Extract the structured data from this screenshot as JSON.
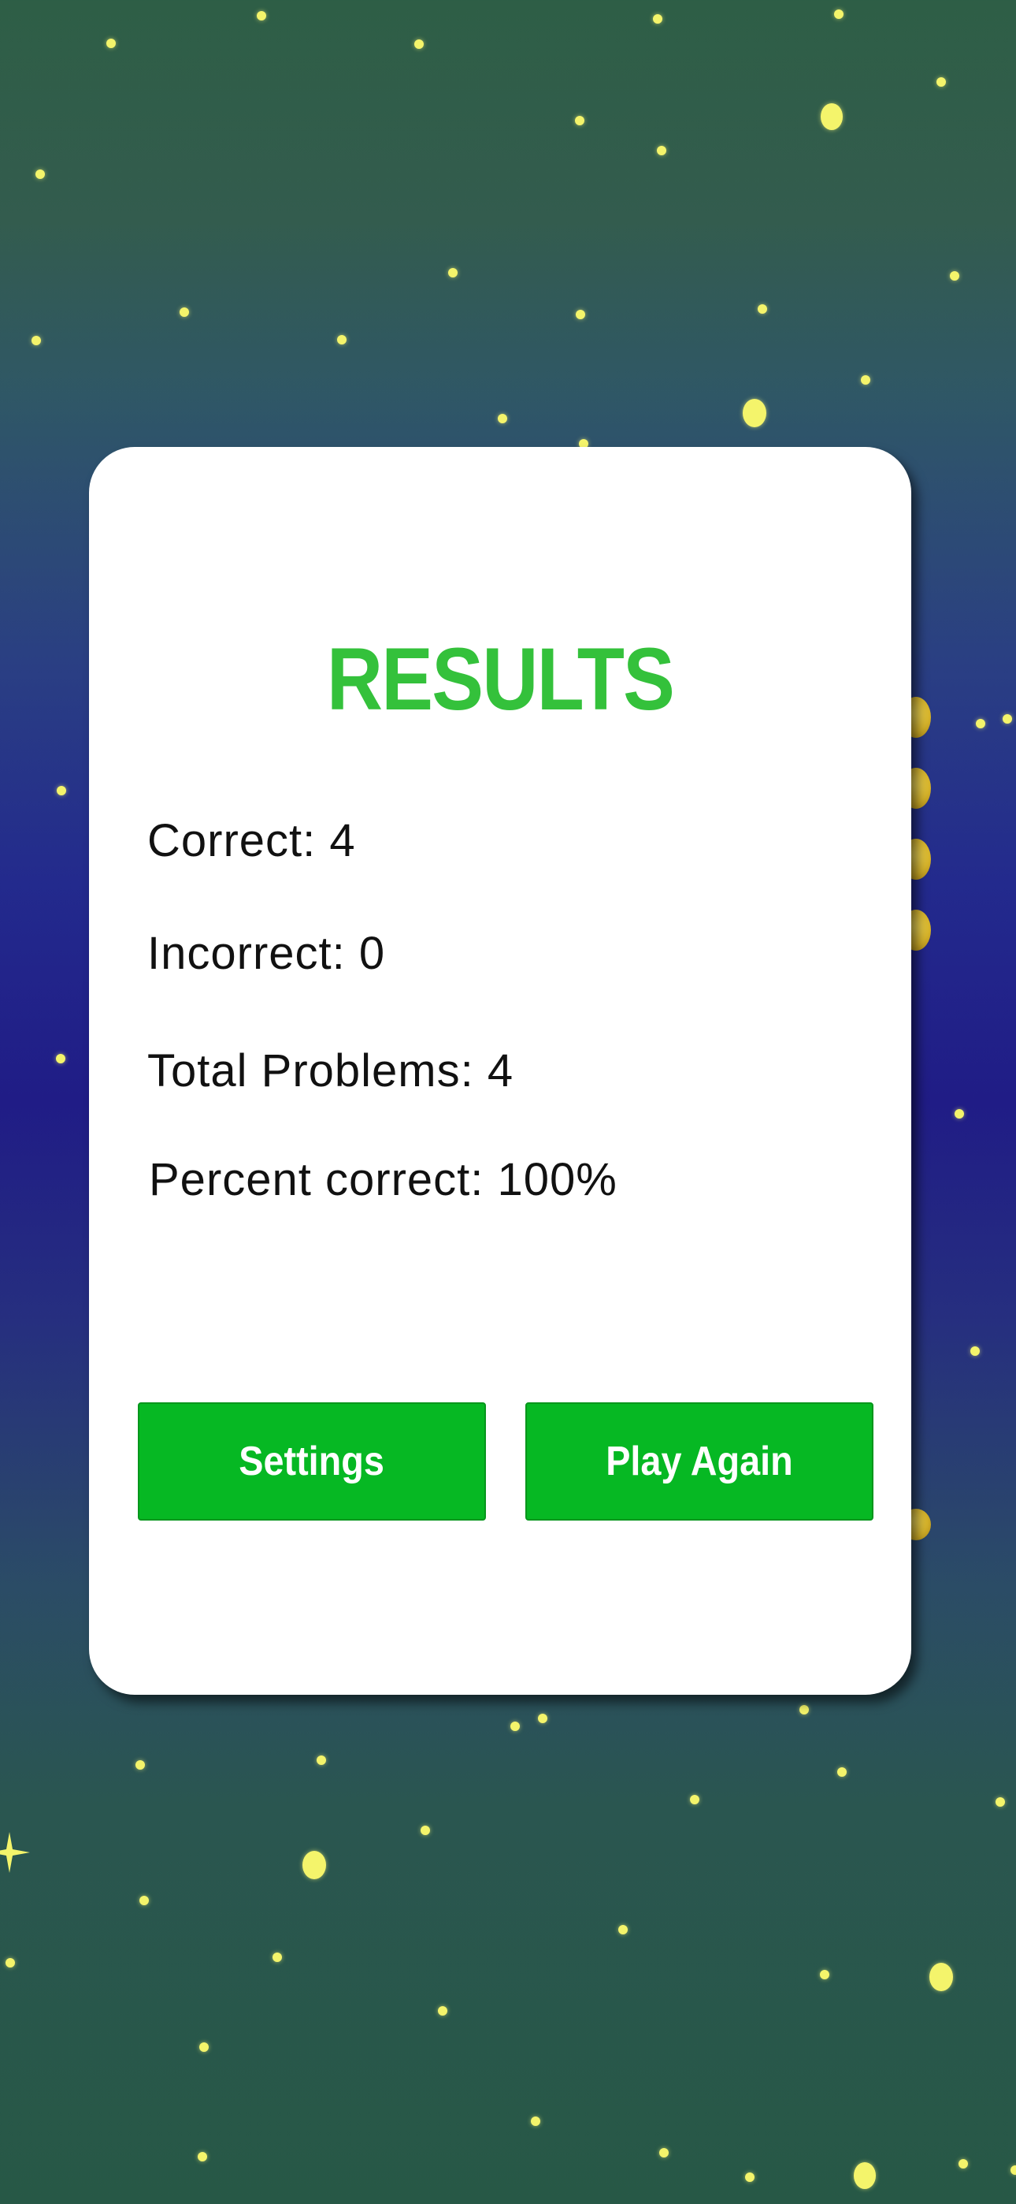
{
  "results": {
    "title": "RESULTS",
    "correct": "Correct: 4",
    "incorrect": "Incorrect: 0",
    "total": "Total Problems: 4",
    "percent": "Percent correct: 100%"
  },
  "buttons": {
    "settings": "Settings",
    "play_again": "Play Again"
  },
  "colors": {
    "title": "#34c13b",
    "button": "#06b823",
    "star": "#f4f46b"
  }
}
